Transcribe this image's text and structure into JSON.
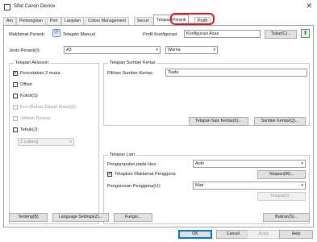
{
  "window": {
    "title": "Sifat Canon Device",
    "close_glyph": "✕"
  },
  "tabs": [
    {
      "label": "Am"
    },
    {
      "label": "Perkongsian"
    },
    {
      "label": "Port"
    },
    {
      "label": "Lanjutan"
    },
    {
      "label": "Colour Management"
    },
    {
      "label": "Securi"
    },
    {
      "label": "Tetapan Peranti",
      "active": true
    },
    {
      "label": "Profil"
    }
  ],
  "header": {
    "device_info_label": "Maklumat Peranti:",
    "manual_settings_label": "Tetapan Manual",
    "config_profile_label": "Profil Konfigurasi:",
    "config_profile_value": "Konfigurasi Asas",
    "change_button": "Tukar(C)..."
  },
  "paper_type": {
    "label": "Jenis Peranti(I):",
    "size_value": "A3",
    "color_value": "Warna"
  },
  "accessories": {
    "title": "Tetapan Aksesori",
    "items": [
      {
        "label": "Pencetakan 2 muka",
        "checked": true,
        "enabled": true
      },
      {
        "label": "Offset",
        "checked": false,
        "enabled": true
      },
      {
        "label": "Kokot(S)",
        "checked": false,
        "enabled": true
      },
      {
        "label": "Eco (Bebas Dawai Kokot)(I)",
        "checked": false,
        "enabled": false
      },
      {
        "label": "Jahitan Pelana",
        "checked": false,
        "enabled": false
      },
      {
        "label": "Tebuk(J):",
        "checked": false,
        "enabled": true
      }
    ],
    "punch_value": "2 Lubang"
  },
  "paper_source": {
    "title": "Tetapan Sumber Kertas",
    "select_label": "Pilihan Sumber Kertas:",
    "select_value": "Tiada",
    "paper_size_button": "Tetapan Saiz Kertas(X)...",
    "paper_source_button": "Sumber Kertas(Q)..."
  },
  "other": {
    "title": "Tetapan Lain",
    "host_spool_label": "Pengumpulan pada Hos:",
    "host_spool_value": "Auto",
    "user_info_label": "Tetapkan Maklumat Pengguna",
    "user_info_checked": true,
    "settings_button": "Tetapan(W)...",
    "user_mgmt_label": "Pengurusan Pengguna(U):",
    "user_mgmt_value": "Mati",
    "settings2_button": "Tetapan(I)..."
  },
  "footer": {
    "font_button": "Tenteng(B)",
    "language_button": "Language Settings(Z)...",
    "function_button": "Fungsi...",
    "about_button": "Butiran(S)...",
    "ok_button": "OK",
    "cancel_button": "Cancel",
    "apply_button": "Apply",
    "help_button": "Help"
  }
}
